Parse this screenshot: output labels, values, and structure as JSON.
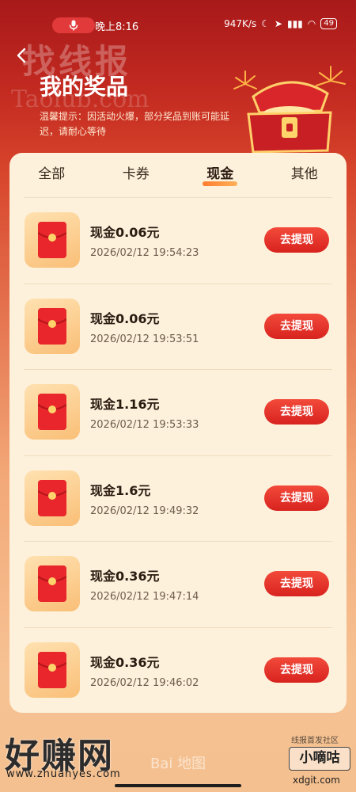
{
  "status_bar": {
    "time": "晚上8:16",
    "network_speed": "947K/s",
    "battery": "49"
  },
  "header": {
    "title": "我的奖品",
    "tip": "温馨提示：因活动火爆，部分奖品到账可能延迟，请耐心等待",
    "watermark": "找线报",
    "watermark_url": "Taolub.com"
  },
  "tabs": [
    {
      "label": "全部"
    },
    {
      "label": "卡券"
    },
    {
      "label": "现金"
    },
    {
      "label": "其他"
    }
  ],
  "active_tab": "现金",
  "items": [
    {
      "title": "现金0.06元",
      "time": "2026/02/12 19:54:23",
      "action": "去提现"
    },
    {
      "title": "现金0.06元",
      "time": "2026/02/12 19:53:51",
      "action": "去提现"
    },
    {
      "title": "现金1.16元",
      "time": "2026/02/12 19:53:33",
      "action": "去提现"
    },
    {
      "title": "现金1.6元",
      "time": "2026/02/12 19:49:32",
      "action": "去提现"
    },
    {
      "title": "现金0.36元",
      "time": "2026/02/12 19:47:14",
      "action": "去提现"
    },
    {
      "title": "现金0.36元",
      "time": "2026/02/12 19:46:02",
      "action": "去提现"
    }
  ],
  "watermarks": {
    "left_logo": "好赚网",
    "left_url": "www.zhuanyes.com",
    "baidu": "Bai 地图",
    "right_label": "线报首发社区",
    "right_name": "小嘀咕",
    "right_url": "xdgit.com"
  },
  "colors": {
    "accent_red": "#d8231f",
    "panel_bg": "#fdf1dc",
    "header_red": "#a8191a"
  }
}
